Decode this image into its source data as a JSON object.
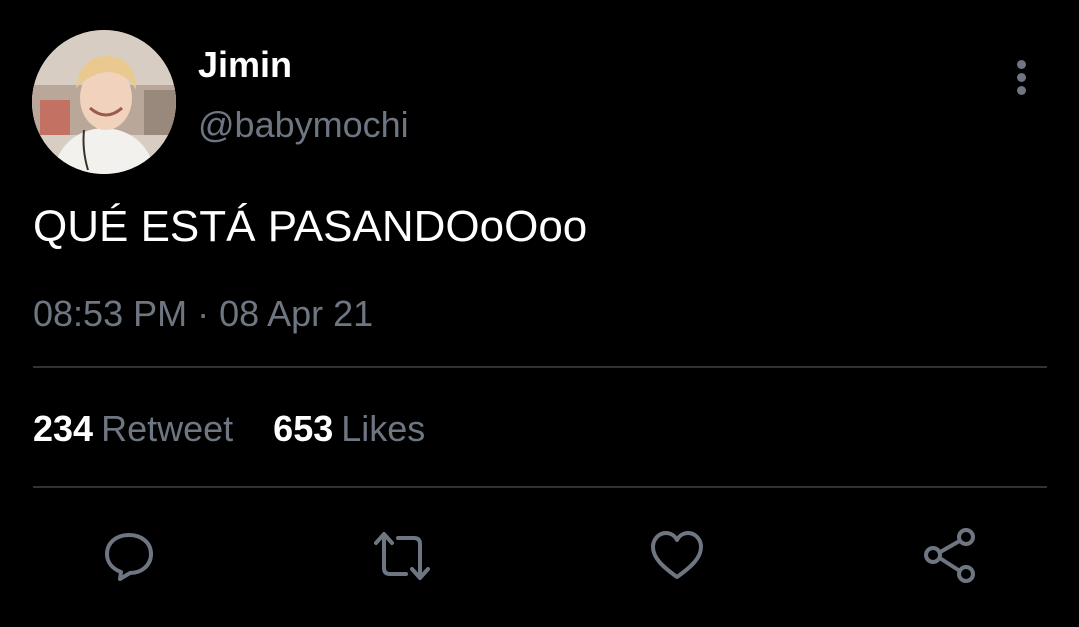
{
  "author": {
    "display_name": "Jimin",
    "handle": "@babymochi"
  },
  "tweet": {
    "text": "QUÉ ESTÁ PASANDOoOoo",
    "timestamp": "08:53 PM · 08 Apr 21"
  },
  "stats": {
    "retweets": {
      "count": "234",
      "label": "Retweet"
    },
    "likes": {
      "count": "653",
      "label": "Likes"
    }
  },
  "actions": [
    {
      "name": "reply",
      "icon": "reply-bubble-icon"
    },
    {
      "name": "retweet",
      "icon": "retweet-arrows-icon"
    },
    {
      "name": "like",
      "icon": "heart-icon"
    },
    {
      "name": "share",
      "icon": "share-nodes-icon"
    }
  ],
  "colors": {
    "background": "#000000",
    "primary_text": "#ffffff",
    "secondary_text": "#6e7681",
    "divider": "#2f3336",
    "icon": "#6e7681"
  }
}
